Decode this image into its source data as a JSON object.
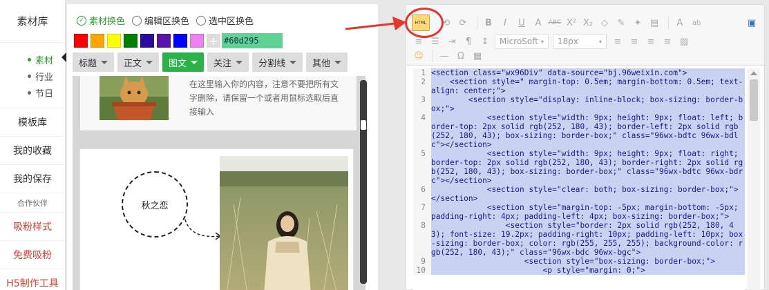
{
  "left_nav": {
    "top": "素材库",
    "sub_items": [
      {
        "label": "素材",
        "active": true
      },
      {
        "label": "行业",
        "active": false
      },
      {
        "label": "节日",
        "active": false
      }
    ],
    "items": [
      {
        "label": "模板库",
        "style": "normal"
      },
      {
        "label": "我的收藏",
        "style": "normal"
      },
      {
        "label": "我的保存",
        "style": "normal"
      },
      {
        "label": "合作伙伴",
        "style": "small"
      },
      {
        "label": "吸粉样式",
        "style": "red"
      },
      {
        "label": "免费吸粉",
        "style": "red"
      },
      {
        "label": "H5制作工具",
        "style": "red"
      }
    ]
  },
  "mid": {
    "radios": [
      {
        "label": "素材换色",
        "checked": true
      },
      {
        "label": "编辑区换色",
        "checked": false
      },
      {
        "label": "选中区换色",
        "checked": false
      }
    ],
    "swatches": [
      "#ff0000",
      "#ffa500",
      "#ffff00",
      "#008000",
      "#2b0ba0",
      "#5b13a8",
      "#0000ff",
      "#ee82ee"
    ],
    "add_label": "+",
    "hex_value": "#60d295",
    "tabs": [
      {
        "label": "标题",
        "active": false
      },
      {
        "label": "正文",
        "active": false
      },
      {
        "label": "图文",
        "active": true
      },
      {
        "label": "关注",
        "active": false
      },
      {
        "label": "分割线",
        "active": false
      },
      {
        "label": "其他",
        "active": false
      }
    ],
    "card1_text": "在这里输入你的内容，注意不要把所有文字删除，请保留一个或者用鼠标选取后直接输入",
    "card2_circle_text": "秋之恋"
  },
  "editor": {
    "html_button": "HTML",
    "font_select": "MicroSoft",
    "size_select": "18px",
    "lines": [
      {
        "n": "1",
        "t": "<section class=\"wx96Div\" data-source=\"bj.96weixin.com\">"
      },
      {
        "n": "2",
        "t": "    <section style=\" margin-top: 0.5em; margin-bottom: 0.5em; text-align: center;\">"
      },
      {
        "n": "3",
        "t": "        <section style=\"display: inline-block; box-sizing: border-box;\">"
      },
      {
        "n": "4",
        "t": "            <section style=\"width: 9px; height: 9px; float: left; border-top: 2px solid rgb(252, 180, 43); border-left: 2px solid rgb(252, 180, 43); box-sizing: border-box;\" class=\"96wx-bdtc 96wx-bdlc\"></section>"
      },
      {
        "n": "5",
        "t": "            <section style=\"width: 9px; height: 9px; float: right; border-top: 2px solid rgb(252, 180, 43); border-right: 2px solid rgb(252, 180, 43); box-sizing: border-box;\" class=\"96wx-bdtc 96wx-bdrc\"></section>"
      },
      {
        "n": "6",
        "t": "            <section style=\"clear: both; box-sizing: border-box;\"></section>"
      },
      {
        "n": "7",
        "t": "            <section style=\"margin-top: -5px; margin-bottom: -5px; padding-right: 4px; padding-left: 4px; box-sizing: border-box;\">"
      },
      {
        "n": "8",
        "t": "                <section style=\"border: 2px solid rgb(252, 180, 43); font-size: 19.2px; padding-right: 10px; padding-left: 10px; box-sizing: border-box; color: rgb(255, 255, 255); background-color: rgb(252, 180, 43);\" class=\"96wx-bdc 96wx-bgc\">"
      },
      {
        "n": "9",
        "t": "                    <section style=\"box-sizing: border-box;\">"
      },
      {
        "n": "10",
        "t": "                        <p style=\"margin: 0;\">"
      }
    ]
  },
  "colors": {
    "accent": "#2bb34a",
    "red": "#e8342a",
    "selection": "#c9d3f1"
  }
}
